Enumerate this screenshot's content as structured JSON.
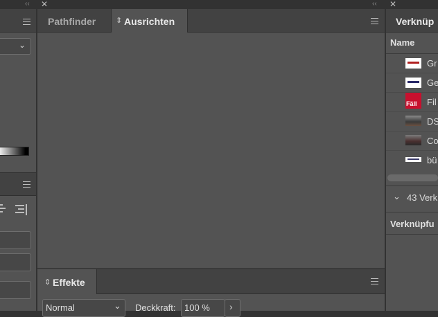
{
  "tabs": {
    "pathfinder": "Pathfinder",
    "ausrichten": "Ausrichten",
    "effekte": "Effekte",
    "verknuepfungen": "Verknüp"
  },
  "effects": {
    "blend_mode": "Normal",
    "opacity_label": "Deckkraft:",
    "opacity_value": "100 %"
  },
  "links": {
    "header": "Name",
    "items": [
      {
        "label": "Gr",
        "thumb": "white-logo"
      },
      {
        "label": "Ge",
        "thumb": "white-logo"
      },
      {
        "label": "Fil",
        "thumb": "red-logo",
        "thumb_text": "Fäll"
      },
      {
        "label": "DS",
        "thumb": "photo"
      },
      {
        "label": "Co",
        "thumb": "photo"
      },
      {
        "label": "bü",
        "thumb": "white-logo"
      }
    ],
    "count_label": "43 Verk",
    "info_label": "Verknüpfu"
  },
  "icons": {
    "close": "✕",
    "collapse": "‹‹",
    "chevron_down": "⌄",
    "chevron_right": "›",
    "sort_arrows": "⇕"
  },
  "colors": {
    "panel_bg": "#535353",
    "tab_bar": "#424242",
    "red_thumb": "#c8102e"
  }
}
